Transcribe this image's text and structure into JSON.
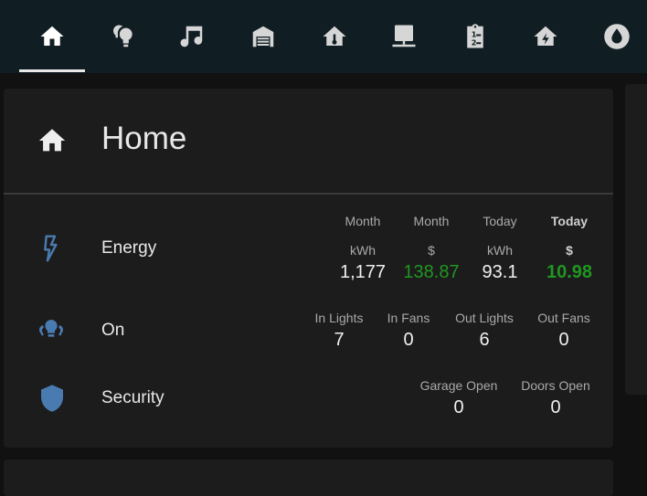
{
  "colors": {
    "topbar_bg": "#101e24",
    "card_bg": "#1c1c1c",
    "icon_blue": "#4a7bb0",
    "value_green": "#209620"
  },
  "tabs": [
    {
      "name": "tab-home",
      "icon": "home-icon"
    },
    {
      "name": "tab-lights",
      "icon": "lightbulb-group-icon"
    },
    {
      "name": "tab-music",
      "icon": "music-note-icon"
    },
    {
      "name": "tab-garage",
      "icon": "garage-icon"
    },
    {
      "name": "tab-home-thermometer",
      "icon": "home-thermometer-icon"
    },
    {
      "name": "tab-network",
      "icon": "server-network-icon"
    },
    {
      "name": "tab-schedule",
      "icon": "clipboard-list-icon"
    },
    {
      "name": "tab-energy",
      "icon": "home-lightning-icon"
    },
    {
      "name": "tab-water",
      "icon": "water-drop-icon"
    }
  ],
  "card": {
    "title": "Home",
    "rows": {
      "energy": {
        "label": "Energy",
        "month_kwh": {
          "h1": "Month",
          "h2": "kWh",
          "value": "1,177"
        },
        "month_cost": {
          "h1": "Month",
          "h2": "$",
          "value": "138.87"
        },
        "today_kwh": {
          "h1": "Today",
          "h2": "kWh",
          "value": "93.1"
        },
        "today_cost": {
          "h1": "Today",
          "h2": "$",
          "value": "10.98"
        }
      },
      "on": {
        "label": "On",
        "in_lights": {
          "h": "In Lights",
          "value": "7"
        },
        "in_fans": {
          "h": "In Fans",
          "value": "0"
        },
        "out_lights": {
          "h": "Out Lights",
          "value": "6"
        },
        "out_fans": {
          "h": "Out Fans",
          "value": "0"
        }
      },
      "security": {
        "label": "Security",
        "garage_open": {
          "h": "Garage Open",
          "value": "0"
        },
        "doors_open": {
          "h": "Doors Open",
          "value": "0"
        }
      }
    }
  }
}
